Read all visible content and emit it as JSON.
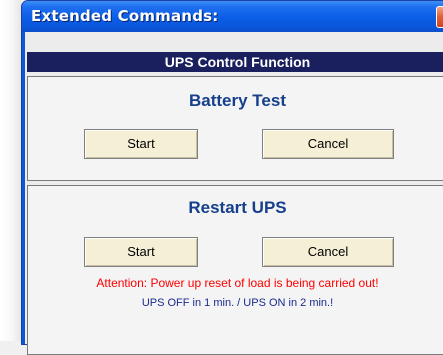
{
  "window": {
    "title": "Extended Commands:",
    "close_glyph": "✕"
  },
  "header": {
    "title": "UPS Control Function"
  },
  "battery_test": {
    "title": "Battery Test",
    "start_label": "Start",
    "cancel_label": "Cancel"
  },
  "restart_ups": {
    "title": "Restart UPS",
    "start_label": "Start",
    "cancel_label": "Cancel",
    "warning": "Attention: Power up reset of load is being carried out!",
    "info": "UPS OFF in 1 min. / UPS ON in 2 min.!"
  },
  "colors": {
    "titlebar": "#0a58d8",
    "header_bar": "#1a1f5e",
    "panel_title": "#163f8c",
    "button_face": "#f5efd6",
    "warning_text": "#ff0000",
    "info_text": "#1a2a8f"
  }
}
